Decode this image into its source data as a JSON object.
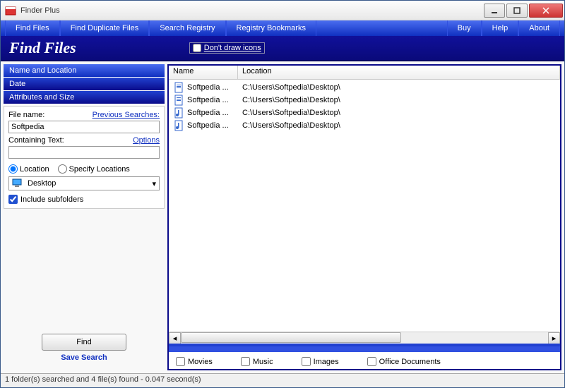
{
  "window": {
    "title": "Finder Plus"
  },
  "menubar": {
    "left": [
      "Find Files",
      "Find Duplicate Files",
      "Search Registry",
      "Registry Bookmarks"
    ],
    "right": [
      "Buy",
      "Help",
      "About"
    ]
  },
  "header": {
    "title": "Find Files",
    "dont_draw_icons_label": "Don't draw icons"
  },
  "tabs": [
    "Name and Location",
    "Date",
    "Attributes and Size"
  ],
  "form": {
    "file_name_label": "File name:",
    "previous_searches_label": "Previous Searches:",
    "file_name_value": "Softpedia",
    "containing_text_label": "Containing Text:",
    "options_label": "Options",
    "location_radio": "Location",
    "specify_radio": "Specify Locations",
    "location_value": "Desktop",
    "include_subfolders_label": "Include subfolders"
  },
  "buttons": {
    "find": "Find",
    "save_search": "Save Search"
  },
  "results": {
    "columns": [
      "Name",
      "Location"
    ],
    "rows": [
      {
        "icon": "doc",
        "name": "Softpedia ...",
        "location": "C:\\Users\\Softpedia\\Desktop\\"
      },
      {
        "icon": "doc",
        "name": "Softpedia ...",
        "location": "C:\\Users\\Softpedia\\Desktop\\"
      },
      {
        "icon": "music",
        "name": "Softpedia ...",
        "location": "C:\\Users\\Softpedia\\Desktop\\"
      },
      {
        "icon": "music",
        "name": "Softpedia ...",
        "location": "C:\\Users\\Softpedia\\Desktop\\"
      }
    ]
  },
  "filters": [
    "Movies",
    "Music",
    "Images",
    "Office Documents"
  ],
  "statusbar": "1 folder(s) searched and 4 file(s) found - 0.047 second(s)"
}
